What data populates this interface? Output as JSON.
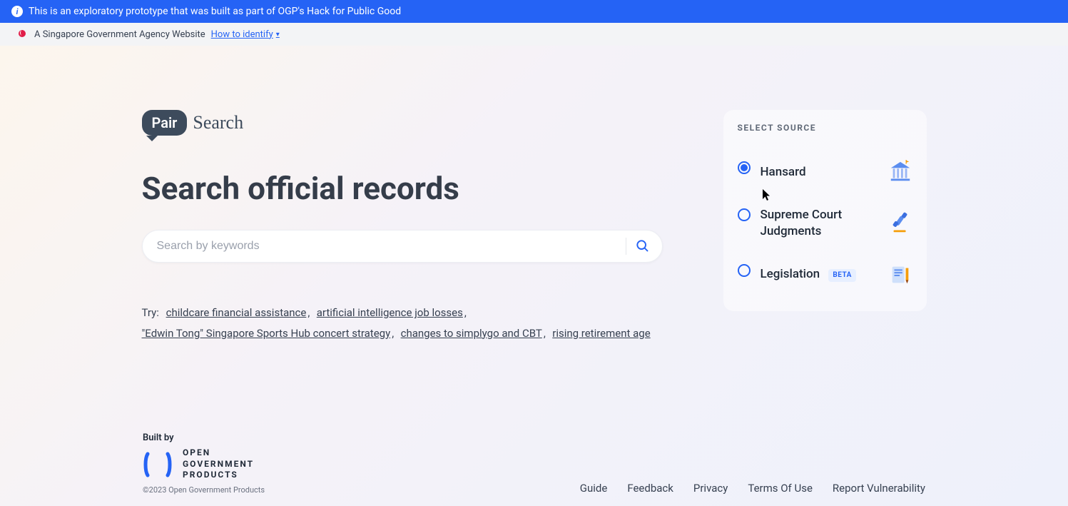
{
  "banner": {
    "text": "This is an exploratory prototype that was built as part of OGP's Hack for Public Good"
  },
  "gov_bar": {
    "text": "A Singapore Government Agency Website",
    "identify_link": "How to identify"
  },
  "brand": {
    "badge": "Pair",
    "text": "Search"
  },
  "page_title": "Search official records",
  "search": {
    "placeholder": "Search by keywords"
  },
  "try": {
    "label": "Try:",
    "items": [
      "childcare financial assistance",
      "artificial intelligence job losses",
      "\"Edwin Tong\" Singapore Sports Hub concert strategy",
      "changes to simplygo and CBT",
      "rising retirement age"
    ]
  },
  "sources": {
    "title": "SELECT SOURCE",
    "items": [
      {
        "label": "Hansard",
        "selected": true,
        "beta": false
      },
      {
        "label": "Supreme Court Judgments",
        "selected": false,
        "beta": false
      },
      {
        "label": "Legislation",
        "selected": false,
        "beta": true
      }
    ],
    "beta_label": "BETA"
  },
  "footer": {
    "built_by_label": "Built by",
    "org_line1": "OPEN",
    "org_line2": "GOVERNMENT",
    "org_line3": "PRODUCTS",
    "copyright": "©2023 Open Government Products",
    "links": [
      "Guide",
      "Feedback",
      "Privacy",
      "Terms Of Use",
      "Report Vulnerability"
    ]
  }
}
